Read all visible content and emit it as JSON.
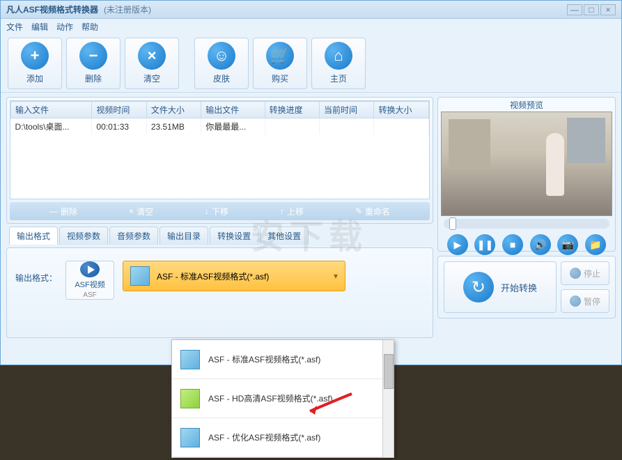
{
  "title": "凡人ASF视频格式转换器",
  "subtitle": "(未注册版本)",
  "menu": {
    "file": "文件",
    "edit": "编辑",
    "action": "动作",
    "help": "帮助"
  },
  "toolbar": {
    "add": "添加",
    "delete": "删除",
    "clear": "清空",
    "skin": "皮肤",
    "buy": "购买",
    "home": "主页"
  },
  "table": {
    "headers": {
      "input": "输入文件",
      "duration": "视频时间",
      "size": "文件大小",
      "output": "输出文件",
      "progress": "转换进度",
      "curtime": "当前时间",
      "outsize": "转换大小"
    },
    "rows": [
      {
        "input": "D:\\tools\\桌面...",
        "duration": "00:01:33",
        "size": "23.51MB",
        "output": "你最最最...",
        "progress": "",
        "curtime": "",
        "outsize": ""
      }
    ],
    "footer": {
      "delete": "删除",
      "clear": "清空",
      "down": "下移",
      "up": "上移",
      "rename": "重命名"
    }
  },
  "tabs": {
    "outfmt": "输出格式",
    "videoparam": "视频参数",
    "audioparam": "音频参数",
    "outdir": "输出目录",
    "convset": "转换设置",
    "otherset": "其他设置"
  },
  "output": {
    "label": "输出格式：",
    "asf_label": "ASF视频",
    "asf_sub": "ASF",
    "selected": "ASF - 标准ASF视频格式(*.asf)"
  },
  "preview": {
    "title": "视频预览"
  },
  "actions": {
    "start": "开始转换",
    "stop": "停止",
    "pause": "暂停"
  },
  "popup": {
    "items": [
      "ASF - 标准ASF视频格式(*.asf)",
      "ASF - HD高清ASF视频格式(*.asf)",
      "ASF - 优化ASF视频格式(*.asf)"
    ]
  },
  "watermark": "安下载"
}
